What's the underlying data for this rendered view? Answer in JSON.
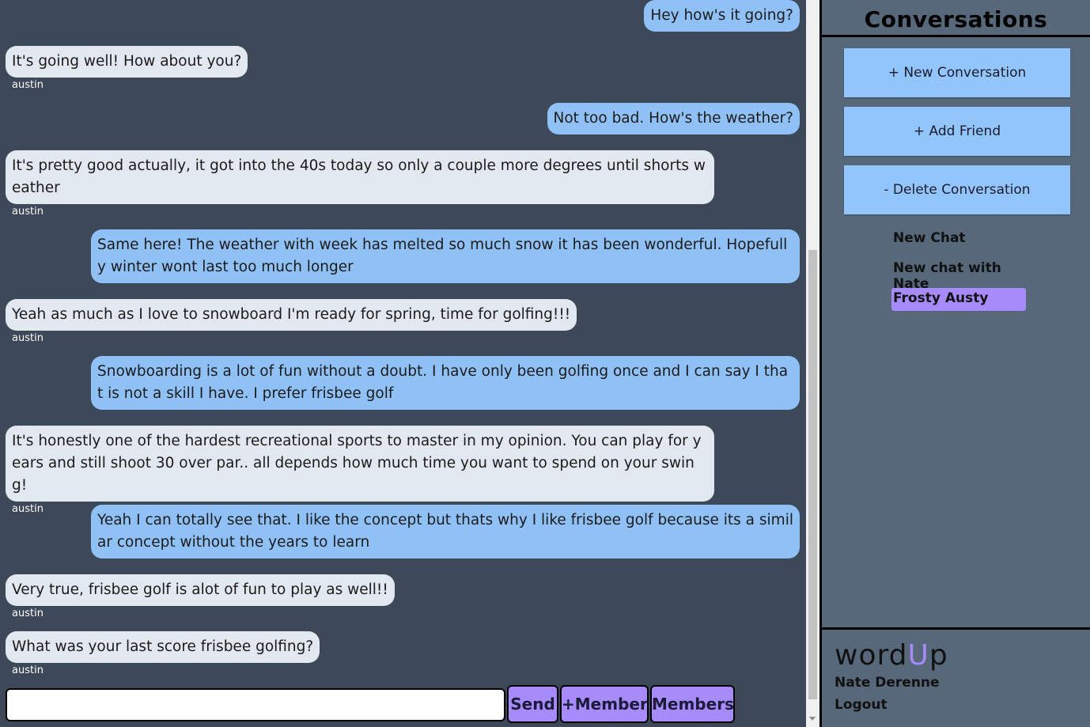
{
  "messages": [
    {
      "text": "Hey how's it going?",
      "mine": true
    },
    {
      "text": "It's going well! How about you?",
      "mine": false,
      "sender": "austin"
    },
    {
      "text": "Not too bad. How's the weather?",
      "mine": true
    },
    {
      "text": "It's pretty good actually, it got into the 40s today so only a couple more degrees until shorts weather",
      "mine": false,
      "sender": "austin"
    },
    {
      "text": "Same here! The weather with week has melted so much snow it has been wonderful. Hopefully winter wont last too much longer",
      "mine": true
    },
    {
      "text": "Yeah as much as I love to snowboard I'm ready for spring, time for golfing!!!",
      "mine": false,
      "sender": "austin"
    },
    {
      "text": "Snowboarding is a lot of fun without a doubt. I have only been golfing once and I can say I that is not a skill I have. I prefer frisbee golf",
      "mine": true
    },
    {
      "text": "It's honestly one of the hardest recreational sports to master in my opinion. You can play for years and still shoot 30 over par.. all depends how much time you want to spend on your swing!",
      "mine": false,
      "sender": "austin"
    },
    {
      "text": "Yeah I can totally see that. I like the concept but thats why I like frisbee golf because its a similar concept without the years to learn",
      "mine": true
    },
    {
      "text": "Very true, frisbee golf is alot of fun to play as well!!",
      "mine": false,
      "sender": "austin"
    },
    {
      "text": "What was your last score frisbee golfing?",
      "mine": false,
      "sender": "austin"
    }
  ],
  "composer": {
    "input_value": "",
    "send_label": "Send",
    "member_label": "+Member",
    "members_label": "Members"
  },
  "sidebar": {
    "title": "Conversations",
    "new_conversation_label": "+ New Conversation",
    "add_friend_label": "+ Add Friend",
    "delete_conversation_label": "- Delete Conversation",
    "conversations": [
      {
        "name": "New Chat",
        "active": false
      },
      {
        "name": "New chat with Nate",
        "active": false
      },
      {
        "name": "Frosty Austy",
        "active": true
      }
    ],
    "brand_prefix": "word",
    "brand_accent": "U",
    "brand_suffix": "p",
    "username": "Nate Derenne",
    "logout_label": "Logout"
  },
  "colors": {
    "chat_background": "#3d4859",
    "sidebar_background": "#56687a",
    "sent_bubble": "#8fc1f7",
    "received_bubble": "#e2e8ef",
    "accent": "#a78bfa",
    "sidebar_button": "#93c5fd"
  }
}
